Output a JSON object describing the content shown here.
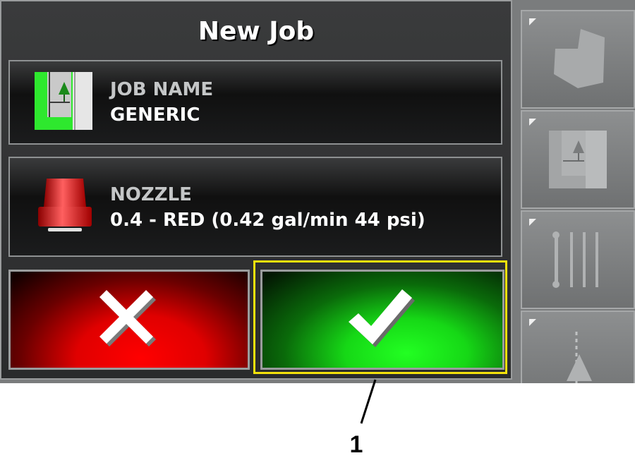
{
  "dialog": {
    "title": "New Job",
    "job_name": {
      "label": "JOB NAME",
      "value": "GENERIC",
      "icon": "field-map-icon"
    },
    "nozzle": {
      "label": "NOZZLE",
      "value": "0.4 - RED (0.42 gal/min 44 psi)",
      "icon": "nozzle-icon"
    },
    "cancel_button": {
      "icon": "close-icon",
      "color": "#ff0000"
    },
    "confirm_button": {
      "icon": "checkmark-icon",
      "color": "#22ff22",
      "highlight_color": "#f3e10c"
    }
  },
  "sidebar": {
    "items": [
      {
        "icon": "field-boundary-icon"
      },
      {
        "icon": "field-map-icon"
      },
      {
        "icon": "boom-sections-icon"
      },
      {
        "icon": "guidance-icon"
      }
    ]
  },
  "callout": {
    "number": "1"
  }
}
